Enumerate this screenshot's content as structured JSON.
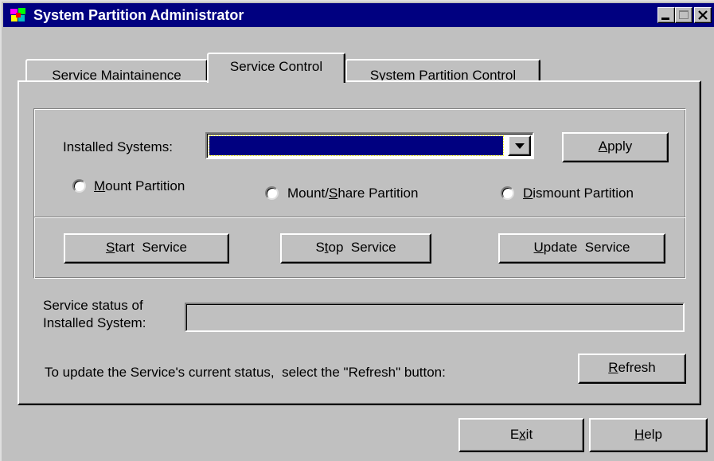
{
  "window": {
    "title": "System Partition Administrator",
    "accent_color": "#000080",
    "app_icon": "multicolor-app-icon"
  },
  "title_controls": {
    "minimize_icon": "minimize-icon",
    "maximize_icon": "maximize-icon",
    "close_icon": "close-icon"
  },
  "tabs": [
    {
      "label": "Service Maintainence",
      "active": false
    },
    {
      "label": "Service Control",
      "active": true
    },
    {
      "label": "System Partition Control",
      "active": false
    }
  ],
  "installed_systems": {
    "label": "Installed Systems:",
    "selected_value": "",
    "dropdown_icon": "chevron-down-icon"
  },
  "apply_button": {
    "pre": "",
    "key": "A",
    "post": "pply"
  },
  "radios": [
    {
      "pre": "",
      "key": "M",
      "post": "ount Partition",
      "checked": false
    },
    {
      "pre": "Mount/",
      "key": "S",
      "post": "hare Partition",
      "checked": false
    },
    {
      "pre": "",
      "key": "D",
      "post": "ismount Partition",
      "checked": false
    }
  ],
  "service_buttons": [
    {
      "pre": "",
      "key": "S",
      "post": "tart  Service"
    },
    {
      "pre": "S",
      "key": "t",
      "post": "op  Service"
    },
    {
      "pre": "",
      "key": "U",
      "post": "pdate  Service"
    }
  ],
  "status": {
    "label_line1": "Service status of",
    "label_line2": "Installed System:",
    "value": ""
  },
  "refresh": {
    "instruction": "To update the Service's current status,  select the \"Refresh\" button:",
    "button": {
      "pre": "",
      "key": "R",
      "post": "efresh"
    }
  },
  "footer": {
    "exit_button": {
      "pre": "E",
      "key": "x",
      "post": "it"
    },
    "help_button": {
      "pre": "",
      "key": "H",
      "post": "elp"
    }
  }
}
